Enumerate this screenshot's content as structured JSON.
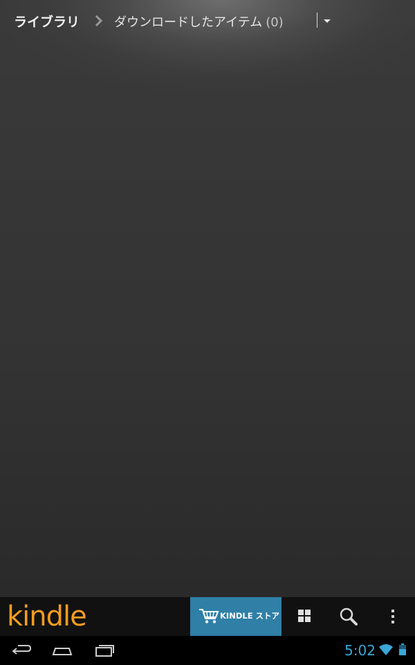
{
  "header": {
    "breadcrumb_root": "ライブラリ",
    "breadcrumb_current": "ダウンロードしたアイテム",
    "item_count": "(0)"
  },
  "toolbar": {
    "logo_text": "kindle",
    "store_label": "KINDLE ストア",
    "icons": [
      "grid-view-icon",
      "search-icon",
      "overflow-menu-icon"
    ]
  },
  "navbar": {
    "buttons": [
      "back-icon",
      "home-icon",
      "recent-apps-icon"
    ],
    "clock": "5:02"
  },
  "colors": {
    "logo": "#f39c1f",
    "store_button": "#2f7fa6",
    "clock": "#3aa7d8"
  }
}
